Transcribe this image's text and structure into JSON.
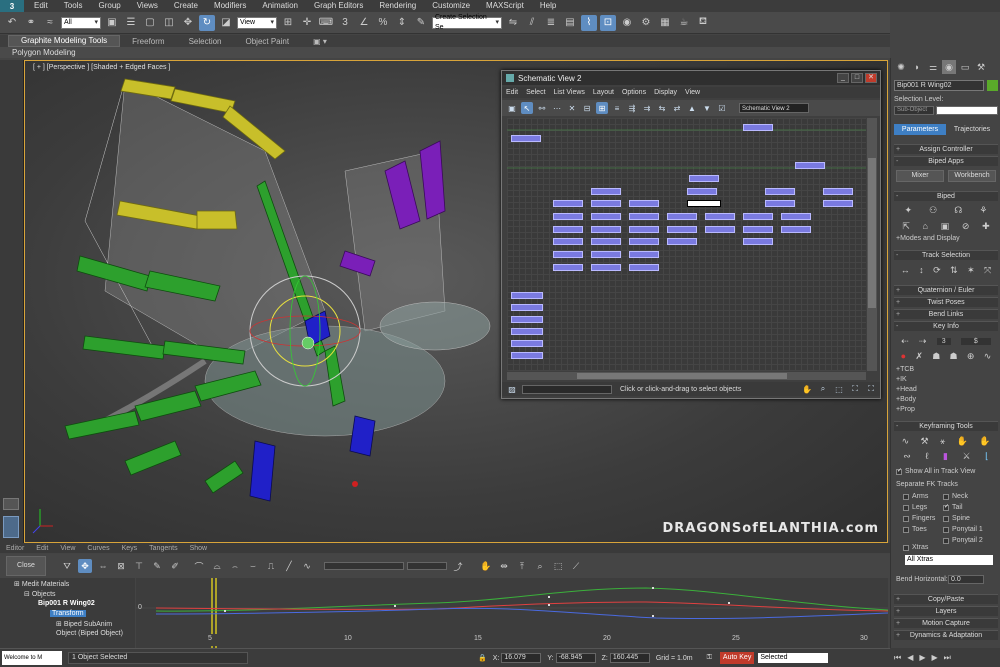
{
  "menubar": {
    "logo": "3",
    "items": [
      "Edit",
      "Tools",
      "Group",
      "Views",
      "Create",
      "Modifiers",
      "Animation",
      "Graph Editors",
      "Rendering",
      "Customize",
      "MAXScript",
      "Help"
    ]
  },
  "toolbar": {
    "filter": "All",
    "coord_system": "View",
    "selection_set": "Create Selection Se"
  },
  "ribbon": {
    "tabs": [
      "Graphite Modeling Tools",
      "Freeform",
      "Selection",
      "Object Paint"
    ],
    "sub": "Polygon Modeling"
  },
  "viewport": {
    "label": "[ + ] [Perspective ] [Shaded + Edged Faces ]",
    "watermark": "DRAGONSofELANTHIA.com"
  },
  "schematic": {
    "title": "Schematic View 2",
    "menu": [
      "Edit",
      "Select",
      "List Views",
      "Layout",
      "Options",
      "Display",
      "View"
    ],
    "field": "Schematic View 2",
    "status": "Click or click-and-drag to select objects"
  },
  "command_panel": {
    "object_name": "Bip001 R Wing02",
    "selection_level": "Selection Level:",
    "subobject": "Sub-Object",
    "tabs": [
      "Parameters",
      "Trajectories"
    ],
    "rollouts": {
      "assign_controller": "Assign Controller",
      "biped_apps": "Biped Apps",
      "mixer": "Mixer",
      "workbench": "Workbench",
      "biped": "Biped",
      "modes_display": "Modes and Display",
      "track_selection": "Track Selection",
      "quaternion": "Quaternion / Euler",
      "twist_poses": "Twist Poses",
      "bend_links": "Bend Links",
      "key_info": "Key Info",
      "key_value": "3",
      "tcb": "TCB",
      "ik": "IK",
      "head": "Head",
      "body": "Body",
      "prop": "Prop",
      "keyframing_tools": "Keyframing Tools",
      "show_all": "Show All in Track View",
      "separate_fk": "Separate FK Tracks",
      "arms": "Arms",
      "neck": "Neck",
      "legs": "Legs",
      "tail": "Tail",
      "fingers": "Fingers",
      "spine": "Spine",
      "toes": "Toes",
      "ponytail1": "Ponytail 1",
      "ponytail2": "Ponytail 2",
      "xtras": "Xtras",
      "all_xtras": "All Xtras",
      "bend_horizontal": "Bend Horizontal:",
      "bend_value": "0.0",
      "copy_paste": "Copy/Paste",
      "layers": "Layers",
      "motion_capture": "Motion Capture",
      "dynamics": "Dynamics & Adaptation"
    }
  },
  "curve_editor": {
    "menu": [
      "Editor",
      "Edit",
      "View",
      "Curves",
      "Keys",
      "Tangents",
      "Show"
    ],
    "close": "Close",
    "tree": {
      "medit": "Medit Materials",
      "objects": "Objects",
      "bip": "Bip001 R Wing02",
      "transform": "Transform",
      "subanim": "Biped SubAnim",
      "object": "Object (Biped Object)"
    },
    "axis": {
      "zero": "0",
      "ticks": [
        "5",
        "10",
        "15",
        "20",
        "25",
        "30"
      ]
    }
  },
  "statusbar": {
    "welcome": "Welcome to M",
    "selected_text": "1 Object Selected",
    "x_label": "X:",
    "x": "16.079",
    "y_label": "Y:",
    "y": "-68.945",
    "z_label": "Z:",
    "z": "160.445",
    "grid": "Grid = 1.0m",
    "autokey": "Auto Key",
    "selected": "Selected"
  }
}
